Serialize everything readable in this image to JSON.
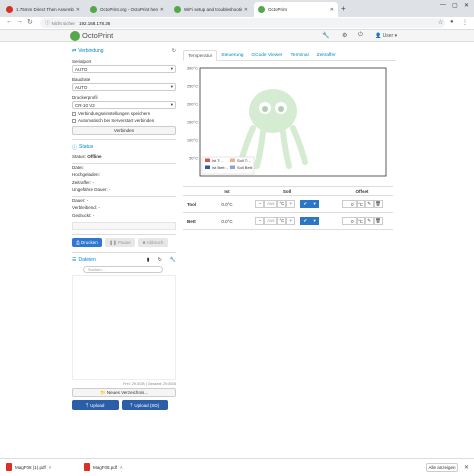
{
  "browser": {
    "tabs": [
      {
        "title": "1.75mm Direct Then Assembly",
        "favicon_color": "#d93025"
      },
      {
        "title": "OctoPrint.org - OctoPrint herunt",
        "favicon_color": "#53a84a"
      },
      {
        "title": "WiFi setup and troubleshooting",
        "favicon_color": "#53a84a"
      },
      {
        "title": "OctoPrint",
        "favicon_color": "#53a84a"
      }
    ],
    "new_tab": "+",
    "security_label": "Nicht sicher",
    "url": "192.168.178.36"
  },
  "header": {
    "brand": "OctoPrint",
    "user": "User"
  },
  "connection": {
    "title": "Verbindung",
    "port_label": "Serialport",
    "port_value": "AUTO",
    "baud_label": "Baudrate",
    "baud_value": "AUTO",
    "profile_label": "Druckerprofil",
    "profile_value": "CR-10 V2",
    "save_settings": "Verbindungseinstellungen speichern",
    "auto_connect": "Automatisch bei Serverstart verbinden",
    "connect_button": "Verbinden"
  },
  "status": {
    "title": "Status",
    "state_label": "Status:",
    "state_value": "Offline",
    "file_line": "Datei:",
    "uploaded_line": "Hochgeladen:",
    "timelapse_line": "Zeitraffer: -",
    "approx_line": "Ungefähre Dauer: -",
    "duration_line": "Dauer: -",
    "remaining_line": "Verbleibend: -",
    "printed_line": "Gedruckt: -",
    "print_button": "Drucken",
    "pause_button": "Pause",
    "cancel_button": "Abbruch"
  },
  "files": {
    "title": "Dateien",
    "search_placeholder": "Suchen...",
    "free_space": "Frei: 29.0GB | Gesamt: 29.8GB",
    "new_folder": "Neues Verzeichnis...",
    "upload": "Upload",
    "upload_sd": "Upload (SD)"
  },
  "main_tabs": [
    "Temperatur",
    "Steuerung",
    "GCode Viewer",
    "Terminal",
    "Zeitraffer"
  ],
  "chart_data": {
    "type": "line",
    "ylim": [
      0,
      300
    ],
    "y_ticks": [
      "300°C",
      "250°C",
      "200°C",
      "150°C",
      "100°C",
      "50°C"
    ],
    "legend_placement": "bottom-left",
    "legend": [
      {
        "label": "Ist T: -",
        "color": "#d9534f"
      },
      {
        "label": "Soll T: -",
        "color": "#f0ad8b"
      },
      {
        "label": "Ist Bett: -",
        "color": "#3355aa"
      },
      {
        "label": "Soll Bett: -",
        "color": "#8da0d8"
      }
    ],
    "series": []
  },
  "temp_table": {
    "headers": [
      "",
      "Ist",
      "Soll",
      "Offset"
    ],
    "rows": [
      {
        "name": "Tool",
        "actual": "0.0°C",
        "target_placeholder": "Aus",
        "unit": "°C",
        "offset": "0"
      },
      {
        "name": "Bett",
        "actual": "0.0°C",
        "target_placeholder": "Aus",
        "unit": "°C",
        "offset": "0"
      }
    ]
  },
  "downloads": {
    "items": [
      "MagF08 (1).pdf",
      "MagF08.pdf"
    ],
    "show_all": "Alle anzeigen"
  }
}
